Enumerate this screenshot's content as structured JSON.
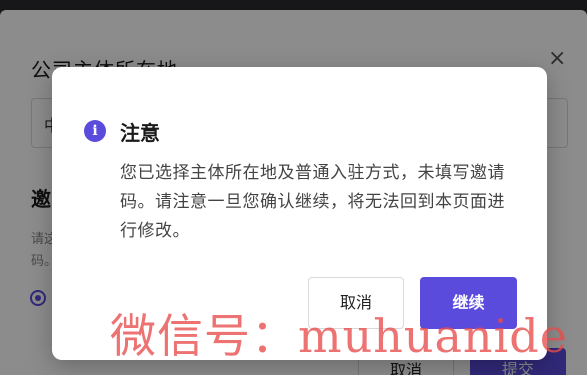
{
  "background_dialog": {
    "title": "公司主体所在地",
    "close_glyph": "×",
    "input_value": "中",
    "section_title": "邀",
    "hint_line1": "请这",
    "hint_line2": "码。",
    "cancel_label": "取消",
    "submit_label": "提交"
  },
  "confirm_dialog": {
    "icon": "info-icon",
    "icon_glyph": "i",
    "title": "注意",
    "body": "您已选择主体所在地及普通入驻方式，未填写邀请码。请注意一旦您确认继续，将无法回到本页面进行修改。",
    "cancel_label": "取消",
    "continue_label": "继续"
  },
  "watermark": {
    "text": "微信号：muhuanide"
  },
  "colors": {
    "accent": "#5a4bdc",
    "watermark": "#e84a4a",
    "overlay": "rgba(0,0,0,0.45)"
  }
}
